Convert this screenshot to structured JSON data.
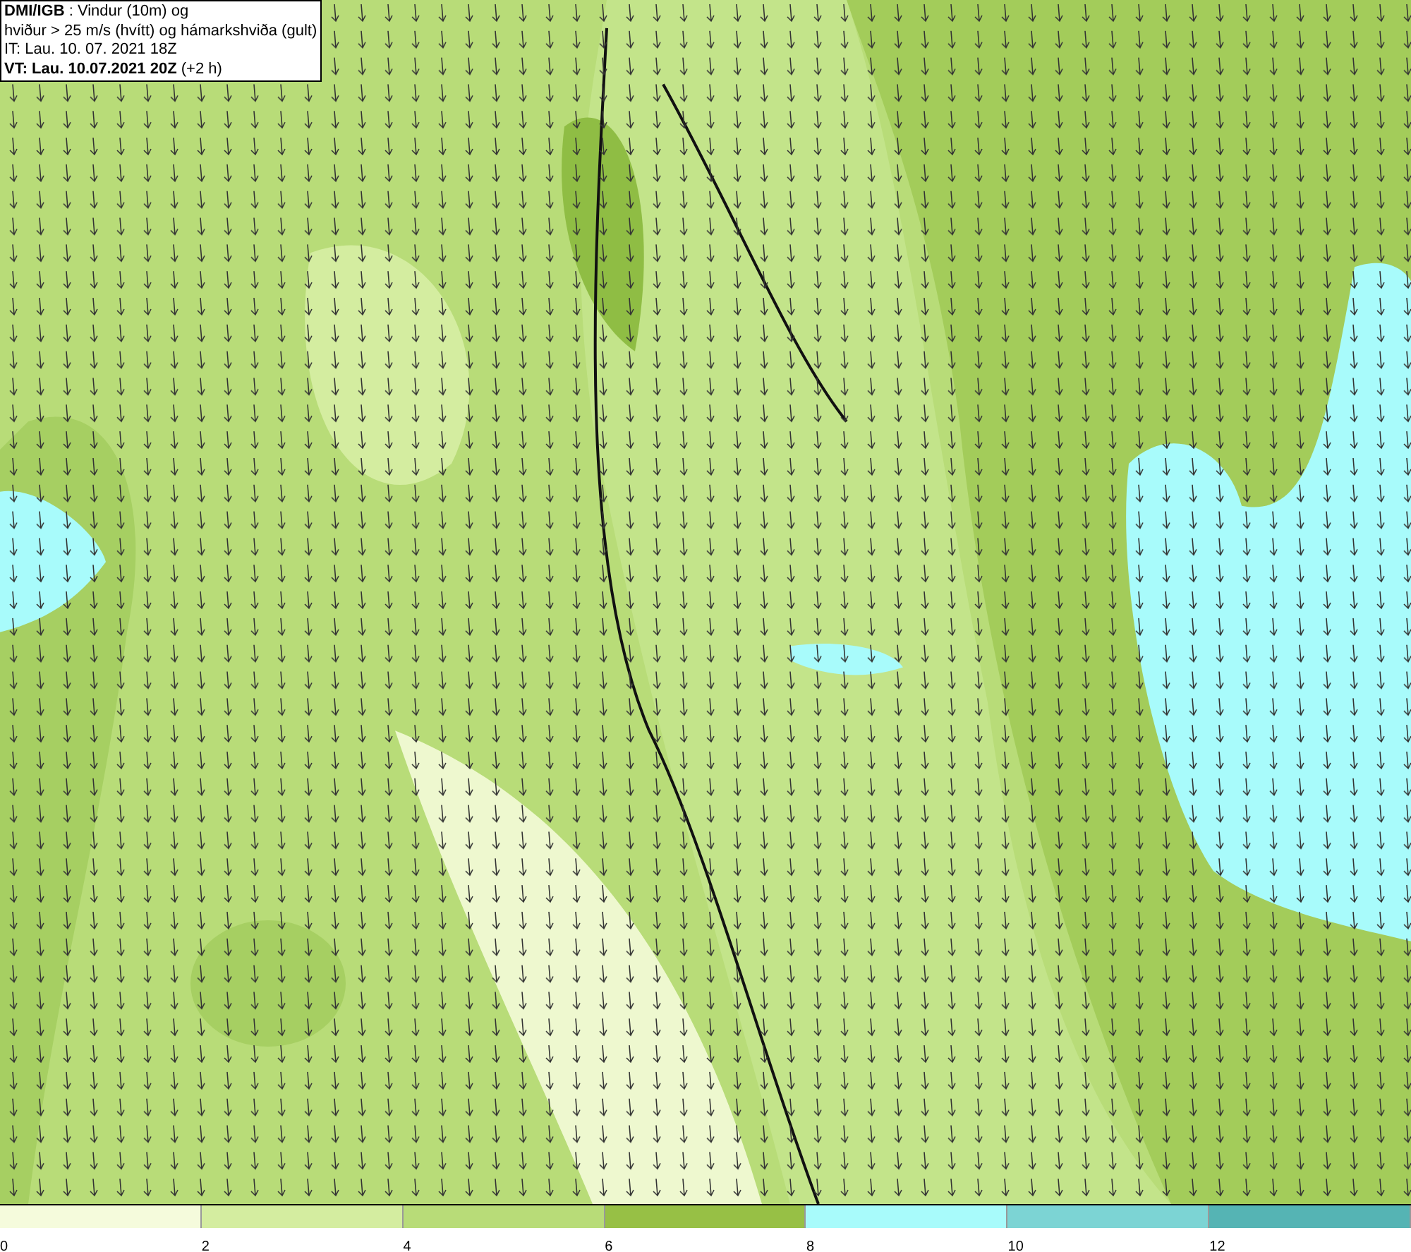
{
  "title_box": {
    "lines": [
      "**DMI/IGB** : Vindur (10m) og",
      "hviður > 25 m/s (hvítt) og hámarkshviða (gult)",
      "IT: Lau. 10. 07. 2021 18Z",
      "**VT: Lau. 10.07.2021 20Z** (+2 h)"
    ]
  },
  "legend": {
    "segments": [
      {
        "label": "0",
        "color": "#f5fbdc"
      },
      {
        "label": "2",
        "color": "#d4eda0"
      },
      {
        "label": "4",
        "color": "#b8dc78"
      },
      {
        "label": "6",
        "color": "#97c045"
      },
      {
        "label": "8",
        "color": "#a8fbfb"
      },
      {
        "label": "10",
        "color": "#7cd4d4"
      },
      {
        "label": "12",
        "color": "#55b4b4"
      }
    ]
  }
}
